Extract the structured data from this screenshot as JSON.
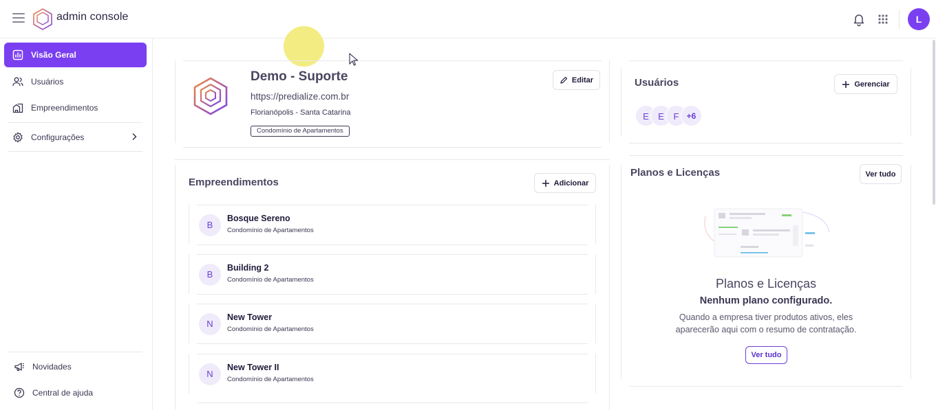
{
  "app": {
    "brand": "admin console",
    "user_initial": "L"
  },
  "sidebar": {
    "items": [
      {
        "label": "Visão Geral",
        "icon": "chart-icon",
        "active": true
      },
      {
        "label": "Usuários",
        "icon": "users-icon"
      },
      {
        "label": "Empreendimentos",
        "icon": "buildings-icon"
      },
      {
        "label": "Configurações",
        "icon": "gear-icon"
      }
    ],
    "footer": [
      {
        "label": "Novidades",
        "icon": "megaphone-icon"
      },
      {
        "label": "Central de ajuda",
        "icon": "help-icon"
      }
    ]
  },
  "company": {
    "name": "Demo - Suporte",
    "url": "https://predialize.com.br",
    "location": "Florianópolis - Santa Catarina",
    "type_tag": "Condomínio de Apartamentos",
    "edit_label": "Editar"
  },
  "empreendimentos": {
    "title": "Empreendimentos",
    "add_label": "Adicionar",
    "items": [
      {
        "initial": "B",
        "name": "Bosque Sereno",
        "type": "Condomínio de Apartamentos"
      },
      {
        "initial": "B",
        "name": "Building 2",
        "type": "Condomínio de Apartamentos"
      },
      {
        "initial": "N",
        "name": "New Tower",
        "type": "Condomínio de Apartamentos"
      },
      {
        "initial": "N",
        "name": "New Tower II",
        "type": "Condomínio de Apartamentos"
      }
    ]
  },
  "usuarios": {
    "title": "Usuários",
    "manage_label": "Gerenciar",
    "avatars": [
      "E",
      "E",
      "F",
      "+6"
    ]
  },
  "planos": {
    "title": "Planos e Licenças",
    "see_all_label": "Ver tudo",
    "empty_title": "Planos e Licenças",
    "empty_subtitle": "Nenhum plano configurado.",
    "empty_text_1": "Quando a empresa tiver produtos ativos, eles",
    "empty_text_2": "aparecerão aqui com o resumo de contratação.",
    "empty_button": "Ver tudo"
  },
  "colors": {
    "accent": "#7a3ff0",
    "highlight": "#f3ec82"
  }
}
